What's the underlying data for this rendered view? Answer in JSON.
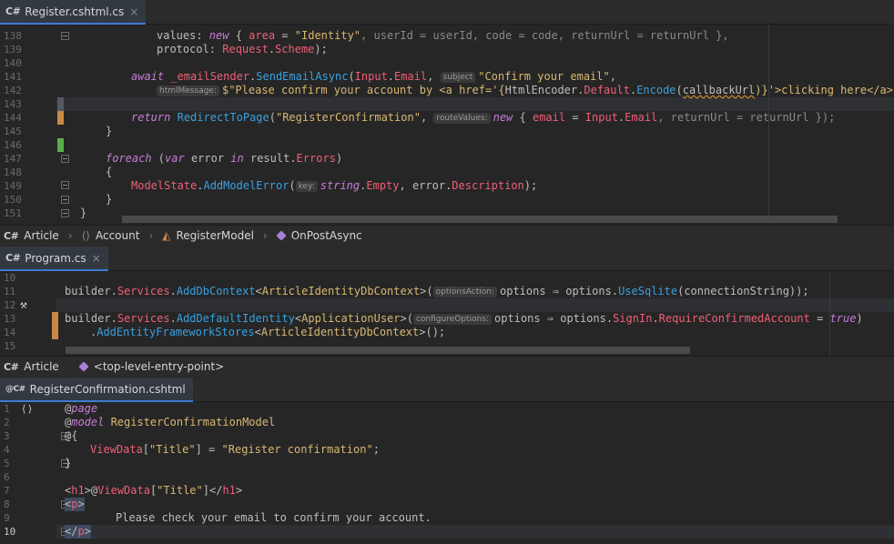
{
  "panes": [
    {
      "tab": {
        "lang": "C#",
        "label": "Register.cshtml.cs",
        "close": "×"
      },
      "lines": [
        "138",
        "139",
        "140",
        "141",
        "142",
        "143",
        "144",
        "145",
        "146",
        "147",
        "148",
        "149",
        "150",
        "151"
      ],
      "code": {
        "l138_a": "values: ",
        "l138_b": "new",
        "l138_c": " { ",
        "l138_d": "area",
        "l138_e": " = ",
        "l138_f": "\"Identity\"",
        "l138_g": ", userId = userId, code = code, returnUrl = returnUrl },",
        "l139_a": "protocol: ",
        "l139_b": "Request",
        "l139_c": ".",
        "l139_d": "Scheme",
        "l139_e": ");",
        "l141_a": "await",
        "l141_b": " _emailSender",
        "l141_c": ".",
        "l141_d": "SendEmailAsync",
        "l141_e": "(",
        "l141_f": "Input",
        "l141_g": ".",
        "l141_h": "Email",
        "l141_i": ", ",
        "l141_hint": "subject",
        "l141_j": "\"Confirm your email\"",
        "l141_k": ",",
        "l142_hint": "htmlMessage:",
        "l142_a": "$\"Please confirm your account by <a href='{",
        "l142_b": "HtmlEncoder",
        "l142_c": ".",
        "l142_d": "Default",
        "l142_e": ".",
        "l142_f": "Encode",
        "l142_g": "(",
        "l142_h": "callbackUrl",
        "l142_i": ")}'>clicking here</a>.\");",
        "l144_a": "return",
        "l144_b": " ",
        "l144_c": "RedirectToPage",
        "l144_d": "(",
        "l144_e": "\"RegisterConfirmation\"",
        "l144_f": ", ",
        "l144_hint": "routeValues:",
        "l144_g": "new",
        "l144_h": " { ",
        "l144_i": "email",
        "l144_j": " = ",
        "l144_k": "Input",
        "l144_l": ".",
        "l144_m": "Email",
        "l144_n": ", returnUrl = returnUrl });",
        "l145": "}",
        "l147_a": "foreach",
        "l147_b": " (",
        "l147_c": "var",
        "l147_d": " error ",
        "l147_e": "in",
        "l147_f": " result.",
        "l147_g": "Errors",
        "l147_h": ")",
        "l148": "{",
        "l149_a": "ModelState",
        "l149_b": ".",
        "l149_c": "AddModelError",
        "l149_d": "(",
        "l149_hint": "key:",
        "l149_e": "string",
        "l149_f": ".",
        "l149_g": "Empty",
        "l149_h": ", error.",
        "l149_i": "Description",
        "l149_j": ");",
        "l150": "}",
        "l151": "}"
      },
      "breadcrumb": {
        "project": "Article",
        "namespace": "Account",
        "class": "RegisterModel",
        "method": "OnPostAsync",
        "sep": "›"
      }
    },
    {
      "tab": {
        "lang": "C#",
        "label": "Program.cs",
        "close": "×"
      },
      "lines": [
        "10",
        "11",
        "12",
        "13",
        "14",
        "15"
      ],
      "code": {
        "l11_a": "builder",
        "l11_b": ".",
        "l11_c": "Services",
        "l11_d": ".",
        "l11_e": "AddDbContext",
        "l11_f": "<",
        "l11_g": "ArticleIdentityDbContext",
        "l11_h": ">(",
        "l11_hint": "optionsAction:",
        "l11_i": "options",
        "l11_j": " ⇒ ",
        "l11_k": "options",
        "l11_l": ".",
        "l11_m": "UseSqlite",
        "l11_n": "(connectionString));",
        "l13_a": "builder",
        "l13_b": ".",
        "l13_c": "Services",
        "l13_d": ".",
        "l13_e": "AddDefaultIdentity",
        "l13_f": "<",
        "l13_g": "ApplicationUser",
        "l13_h": ">(",
        "l13_hint": "configureOptions:",
        "l13_i": "options",
        "l13_j": " ⇒ ",
        "l13_k": "options",
        "l13_l": ".",
        "l13_m": "SignIn",
        "l13_n": ".",
        "l13_o": "RequireConfirmedAccount",
        "l13_p": " = ",
        "l13_q": "true",
        "l13_r": ")",
        "l14_a": ".",
        "l14_b": "AddEntityFrameworkStores",
        "l14_c": "<",
        "l14_d": "ArticleIdentityDbContext",
        "l14_e": ">();"
      },
      "breadcrumb": {
        "project": "Article",
        "entry": "<top-level-entry-point>"
      }
    },
    {
      "tab": {
        "lang": "C#",
        "label": "RegisterConfirmation.cshtml"
      },
      "lines": [
        "1",
        "2",
        "3",
        "4",
        "5",
        "6",
        "7",
        "8",
        "9",
        "10"
      ],
      "code": {
        "l1_a": "@",
        "l1_b": "page",
        "l2_a": "@",
        "l2_b": "model",
        "l2_c": " RegisterConfirmationModel",
        "l3": "@{",
        "l4_a": "ViewData",
        "l4_b": "[",
        "l4_c": "\"Title\"",
        "l4_d": "] = ",
        "l4_e": "\"Register confirmation\"",
        "l4_f": ";",
        "l5": "}",
        "l7_a": "<",
        "l7_b": "h1",
        "l7_c": ">@",
        "l7_d": "ViewData",
        "l7_e": "[",
        "l7_f": "\"Title\"",
        "l7_g": "]</",
        "l7_h": "h1",
        "l7_i": ">",
        "l8_a": "<",
        "l8_b": "p",
        "l8_c": ">",
        "l9": "Please check your email to confirm your account.",
        "l10_a": "</",
        "l10_b": "p",
        "l10_c": ">"
      }
    }
  ],
  "colors": {
    "accent": "#3c7bd1",
    "modified": "#c88a45",
    "added": "#5cae4a",
    "keyword": "#c77dd8",
    "string": "#d9b872",
    "field": "#ee5f78",
    "method": "#39a0e0"
  }
}
